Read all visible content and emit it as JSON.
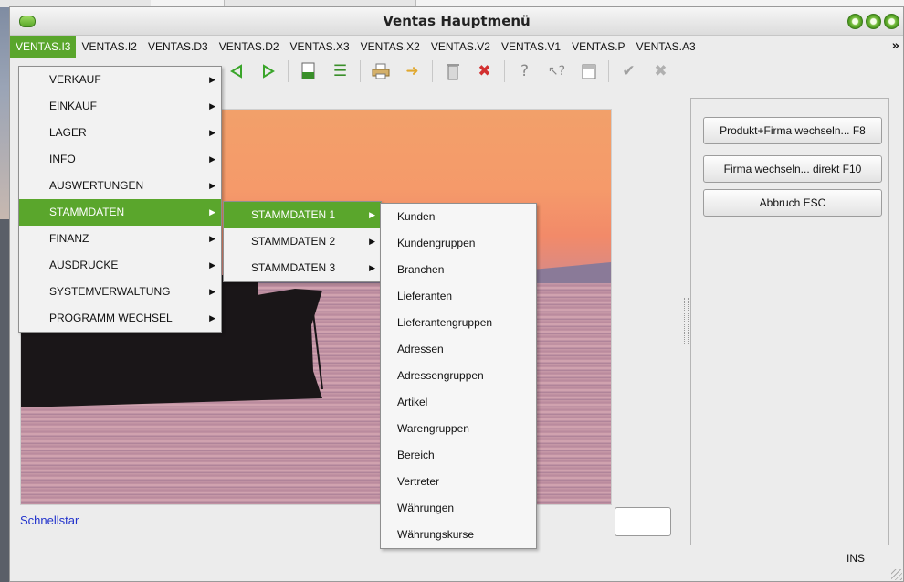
{
  "window": {
    "title": "Ventas Hauptmenü"
  },
  "menubar": {
    "items": [
      "VENTAS.I3",
      "VENTAS.I2",
      "VENTAS.D3",
      "VENTAS.D2",
      "VENTAS.X3",
      "VENTAS.X2",
      "VENTAS.V2",
      "VENTAS.V1",
      "VENTAS.P",
      "VENTAS.A3"
    ],
    "active_index": 0,
    "overflow": "»"
  },
  "toolbar": {
    "icons": [
      "folder-open-icon",
      "back-icon",
      "forward-icon",
      "export-text-icon",
      "list-icon",
      "print-icon",
      "arrow-right-icon",
      "trash-icon",
      "delete-icon",
      "help-icon",
      "context-help-icon",
      "calendar-icon",
      "check-icon",
      "cancel-icon"
    ]
  },
  "menu_level1": {
    "items": [
      "VERKAUF",
      "EINKAUF",
      "LAGER",
      "INFO",
      "AUSWERTUNGEN",
      "STAMMDATEN",
      "FINANZ",
      "AUSDRUCKE",
      "SYSTEMVERWALTUNG",
      "PROGRAMM WECHSEL"
    ],
    "selected": "STAMMDATEN"
  },
  "menu_level2": {
    "items": [
      "STAMMDATEN 1",
      "STAMMDATEN 2",
      "STAMMDATEN 3"
    ],
    "selected": "STAMMDATEN 1"
  },
  "menu_level3": {
    "items": [
      "Kunden",
      "Kundengruppen",
      "Branchen",
      "Lieferanten",
      "Lieferantengruppen",
      "Adressen",
      "Adressengruppen",
      "Artikel",
      "Warengruppen",
      "Bereich",
      "Vertreter",
      "Währungen",
      "Währungskurse"
    ]
  },
  "quickstart": {
    "label": "Schnellstar"
  },
  "right_panel": {
    "buttons": [
      "Produkt+Firma wechseln... F8",
      "Firma wechseln... direkt F10",
      "Abbruch ESC"
    ]
  },
  "status": {
    "mode": "INS"
  },
  "colors": {
    "accent": "#5aa62c",
    "link": "#2233cc"
  }
}
